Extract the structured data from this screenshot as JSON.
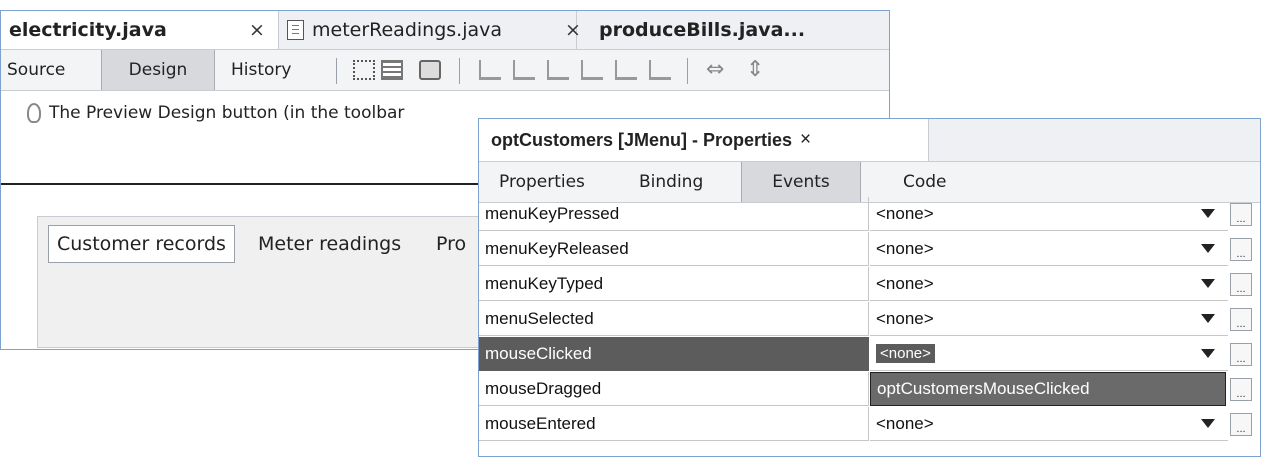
{
  "editor": {
    "tabs": [
      {
        "label": "electricity.java",
        "close": "×"
      },
      {
        "label": "meterReadings.java",
        "close": "×"
      },
      {
        "label": "produceBills.java..."
      }
    ],
    "views": [
      "Source",
      "Design",
      "History"
    ],
    "hint": "The Preview Design button (in the toolbar",
    "form_tabs": [
      "Customer records",
      "Meter readings",
      "Pro"
    ]
  },
  "properties_window": {
    "title": "optCustomers [JMenu] - Properties",
    "close": "×",
    "tabs": [
      "Properties",
      "Binding",
      "Events",
      "Code"
    ],
    "rows": [
      {
        "name": "menuKeyPressed",
        "value": "<none>"
      },
      {
        "name": "menuKeyReleased",
        "value": "<none>"
      },
      {
        "name": "menuKeyTyped",
        "value": "<none>"
      },
      {
        "name": "menuSelected",
        "value": "<none>"
      },
      {
        "name": "mouseClicked",
        "value": "<none>"
      },
      {
        "name": "mouseDragged",
        "value": "optCustomersMouseClicked"
      },
      {
        "name": "mouseEntered",
        "value": "<none>"
      }
    ],
    "ellipsis": "..."
  }
}
